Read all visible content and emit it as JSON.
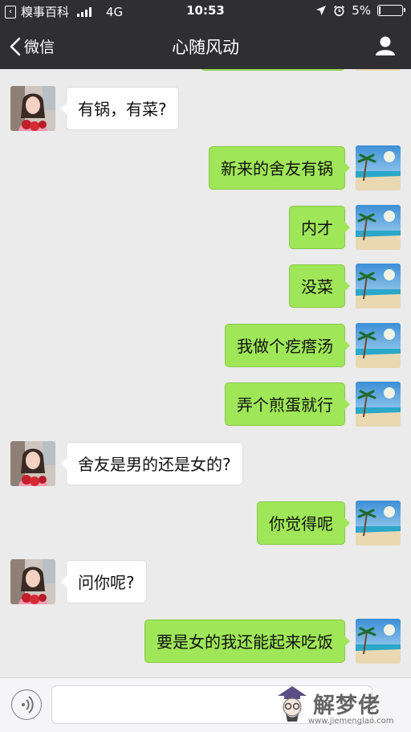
{
  "status_bar": {
    "back_app_label": "糗事百科",
    "network": "4G",
    "time": "10:53",
    "battery_text": "5%",
    "battery_level": 0.05
  },
  "nav": {
    "back_label": "微信",
    "title": "心随风动"
  },
  "messages": [
    {
      "from": "friend",
      "text": "有锅，有菜?"
    },
    {
      "from": "me",
      "text": "新来的舍友有锅"
    },
    {
      "from": "me",
      "text": "内才"
    },
    {
      "from": "me",
      "text": "没菜"
    },
    {
      "from": "me",
      "text": "我做个疙瘩汤"
    },
    {
      "from": "me",
      "text": "弄个煎蛋就行"
    },
    {
      "from": "friend",
      "text": "舍友是男的还是女的?"
    },
    {
      "from": "me",
      "text": "你觉得呢"
    },
    {
      "from": "friend",
      "text": "问你呢?"
    },
    {
      "from": "me",
      "text": "要是女的我还能起来吃饭"
    }
  ],
  "watermark": {
    "text": "解梦佬",
    "url": "www.jiemenglao.com"
  },
  "colors": {
    "bar_bg": "#2e2e33",
    "chat_bg": "#ebebeb",
    "my_bubble": "#9fe658",
    "friend_bubble": "#ffffff"
  }
}
